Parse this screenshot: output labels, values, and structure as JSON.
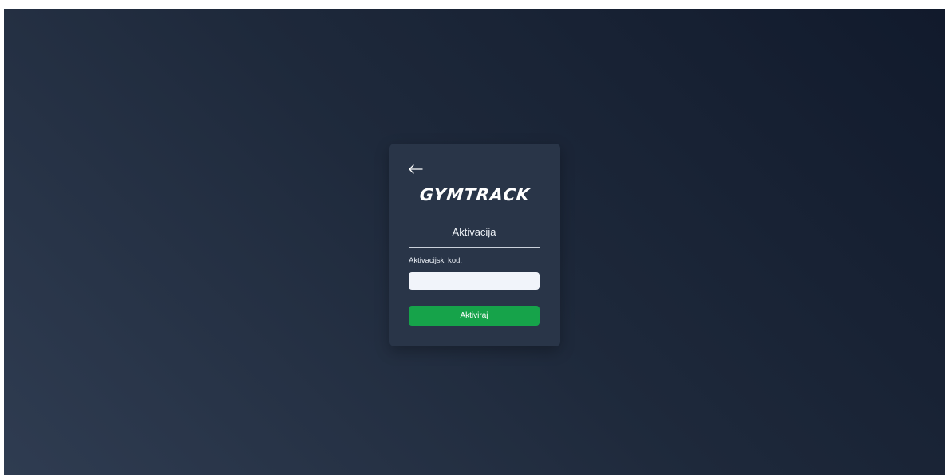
{
  "colors": {
    "background_top": "#111a2c",
    "background_bottom": "#2f3c51",
    "card": "#293548",
    "button": "#16a34a",
    "input_bg": "#f1f4fa"
  },
  "back": {
    "icon": "arrow-left-icon"
  },
  "brand": {
    "logo_text": "GYMTRACK"
  },
  "form": {
    "title": "Aktivacija",
    "code_label": "Aktivacijski kod:",
    "code_value": "",
    "submit_label": "Aktiviraj"
  }
}
